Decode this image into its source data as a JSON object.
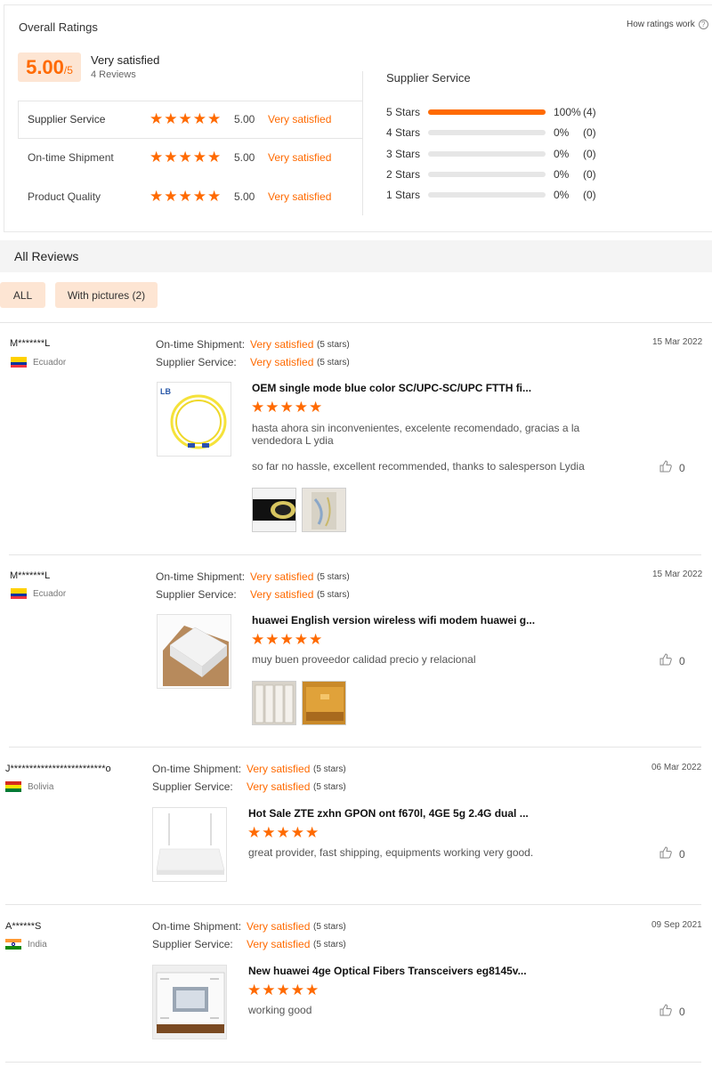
{
  "overall": {
    "title": "Overall Ratings",
    "how_link": "How ratings work",
    "score": "5.00",
    "score_suffix": "/5",
    "verdict": "Very satisfied",
    "review_count": "4 Reviews",
    "rows": [
      {
        "label": "Supplier Service",
        "score": "5.00",
        "verdict": "Very satisfied"
      },
      {
        "label": "On-time Shipment",
        "score": "5.00",
        "verdict": "Very satisfied"
      },
      {
        "label": "Product Quality",
        "score": "5.00",
        "verdict": "Very satisfied"
      }
    ],
    "breakdown_title": "Supplier Service",
    "breakdown": [
      {
        "label": "5 Stars",
        "fraction": 1.0,
        "pct": "100%",
        "count": "(4)"
      },
      {
        "label": "4 Stars",
        "fraction": 0,
        "pct": "0%",
        "count": "(0)"
      },
      {
        "label": "3 Stars",
        "fraction": 0,
        "pct": "0%",
        "count": "(0)"
      },
      {
        "label": "2 Stars",
        "fraction": 0,
        "pct": "0%",
        "count": "(0)"
      },
      {
        "label": "1 Stars",
        "fraction": 0,
        "pct": "0%",
        "count": "(0)"
      }
    ]
  },
  "all_reviews": {
    "title": "All Reviews",
    "filters": [
      "ALL",
      "With pictures (2)"
    ]
  },
  "labels": {
    "shipment": "On-time Shipment:",
    "service": "Supplier Service:",
    "very_satisfied": "Very satisfied",
    "five_stars": "(5 stars)"
  },
  "reviews": [
    {
      "user": "M*******L",
      "country": "Ecuador",
      "date": "15 Mar 2022",
      "product": "OEM single mode blue color SC/UPC-SC/UPC FTTH fi...",
      "text": "hasta ahora sin inconvenientes, excelente recomendado, gracias a la vendedora L ydia",
      "translation": "so far no hassle, excellent recommended, thanks to salesperson Lydia",
      "likes": "0"
    },
    {
      "user": "M*******L",
      "country": "Ecuador",
      "date": "15 Mar 2022",
      "product": "huawei English version wireless wifi modem huawei g...",
      "text": "muy buen proveedor calidad precio y relacional",
      "likes": "0"
    },
    {
      "user": "J*************************o",
      "country": "Bolivia",
      "date": "06 Mar 2022",
      "product": "Hot Sale ZTE zxhn GPON ont f670l, 4GE 5g 2.4G dual ...",
      "text": "great provider, fast shipping, equipments working very good.",
      "likes": "0"
    },
    {
      "user": "A******S",
      "country": "India",
      "date": "09 Sep 2021",
      "product": "New huawei 4ge Optical Fibers Transceivers eg8145v...",
      "text": "working good",
      "likes": "0"
    }
  ],
  "colors": {
    "accent": "#ff6a00",
    "badge_bg": "#fde5d3"
  }
}
